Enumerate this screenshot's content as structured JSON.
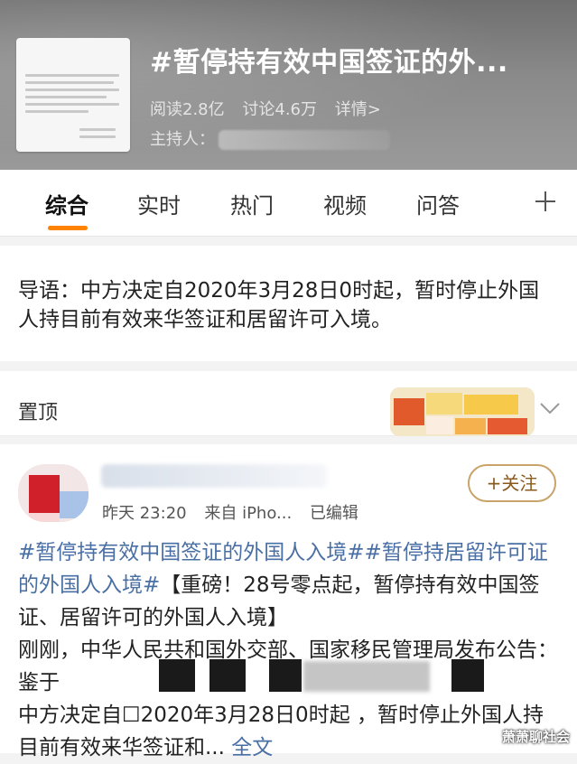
{
  "topic": {
    "title": "#暂停持有效中国签证的外...",
    "read_count": "阅读2.8亿",
    "discuss_count": "讨论4.6万",
    "detail_link": "详情>",
    "host_label": "主持人："
  },
  "tabs": [
    {
      "label": "综合",
      "active": true
    },
    {
      "label": "实时",
      "active": false
    },
    {
      "label": "热门",
      "active": false
    },
    {
      "label": "视频",
      "active": false
    },
    {
      "label": "问答",
      "active": false
    }
  ],
  "intro": {
    "text": "导语：中方决定自2020年3月28日0时起，暂时停止外国人持目前有效来华签证和居留许可入境。"
  },
  "pinned": {
    "label": "置顶"
  },
  "post": {
    "time": "昨天 23:20",
    "source": "来自 iPho...",
    "edited": "已编辑",
    "follow_label": "+关注",
    "hashtags": "#暂停持有效中国签证的外国人入境##暂停持居留许可证的外国人入境#",
    "headline": "【重磅！28号零点起，暂停持有效中国签证、居留许可的外国人入境】",
    "body_start": "刚刚，中华人民共和国外交部、国家移民管理局发布公告：鉴于",
    "body_line2": "中方决定自",
    "body_line2_b": "2020年3月28日0时起  ，暂时停止外国人持目前有效来华签证和...",
    "fulltext_link": "全文"
  },
  "watermark": "萧萧聊社会",
  "colors": {
    "accent_orange": "#ff8200",
    "link_blue": "#4a6fa5",
    "follow_border": "#c8a36a"
  }
}
